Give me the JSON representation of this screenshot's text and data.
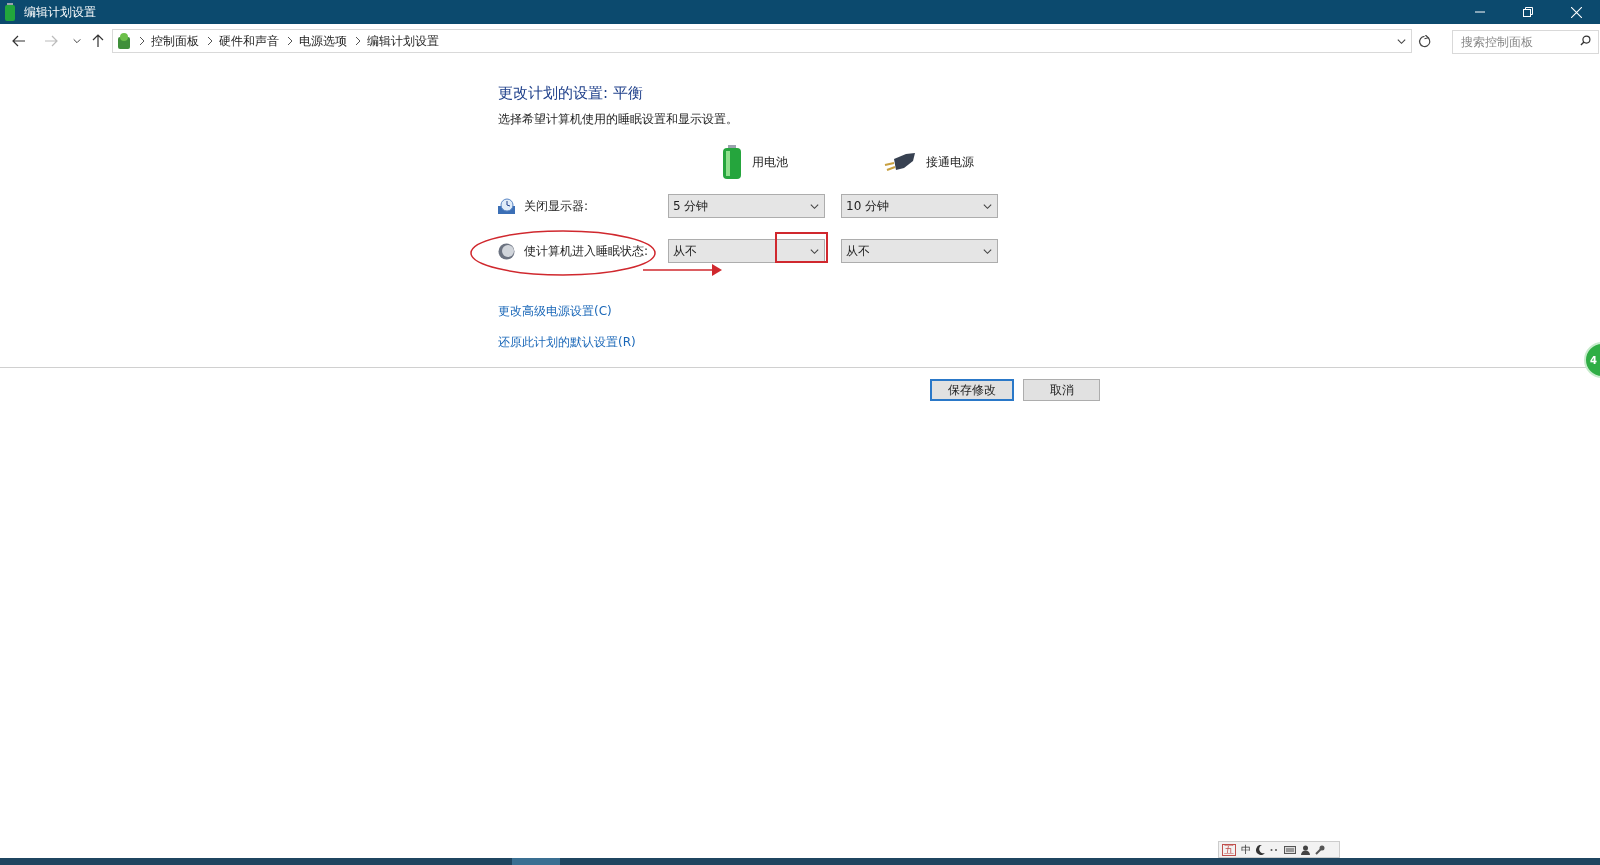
{
  "window": {
    "title": "编辑计划设置"
  },
  "breadcrumb": [
    "控制面板",
    "硬件和声音",
    "电源选项",
    "编辑计划设置"
  ],
  "search": {
    "placeholder": "搜索控制面板"
  },
  "heading": "更改计划的设置: 平衡",
  "description": "选择希望计算机使用的睡眠设置和显示设置。",
  "columns": [
    {
      "kind": "battery",
      "label": "用电池"
    },
    {
      "kind": "plug",
      "label": "接通电源"
    }
  ],
  "settings": [
    {
      "kind": "display",
      "label": "关闭显示器:",
      "values": [
        "5 分钟",
        "10 分钟"
      ]
    },
    {
      "kind": "sleep",
      "label": "使计算机进入睡眠状态:",
      "values": [
        "从不",
        "从不"
      ]
    }
  ],
  "links": [
    "更改高级电源设置(C)",
    "还原此计划的默认设置(R)"
  ],
  "buttons": [
    {
      "label": "保存修改",
      "default": true
    },
    {
      "label": "取消",
      "default": false
    }
  ],
  "side_badge": "4",
  "ime_bar": [
    "五",
    "中"
  ]
}
